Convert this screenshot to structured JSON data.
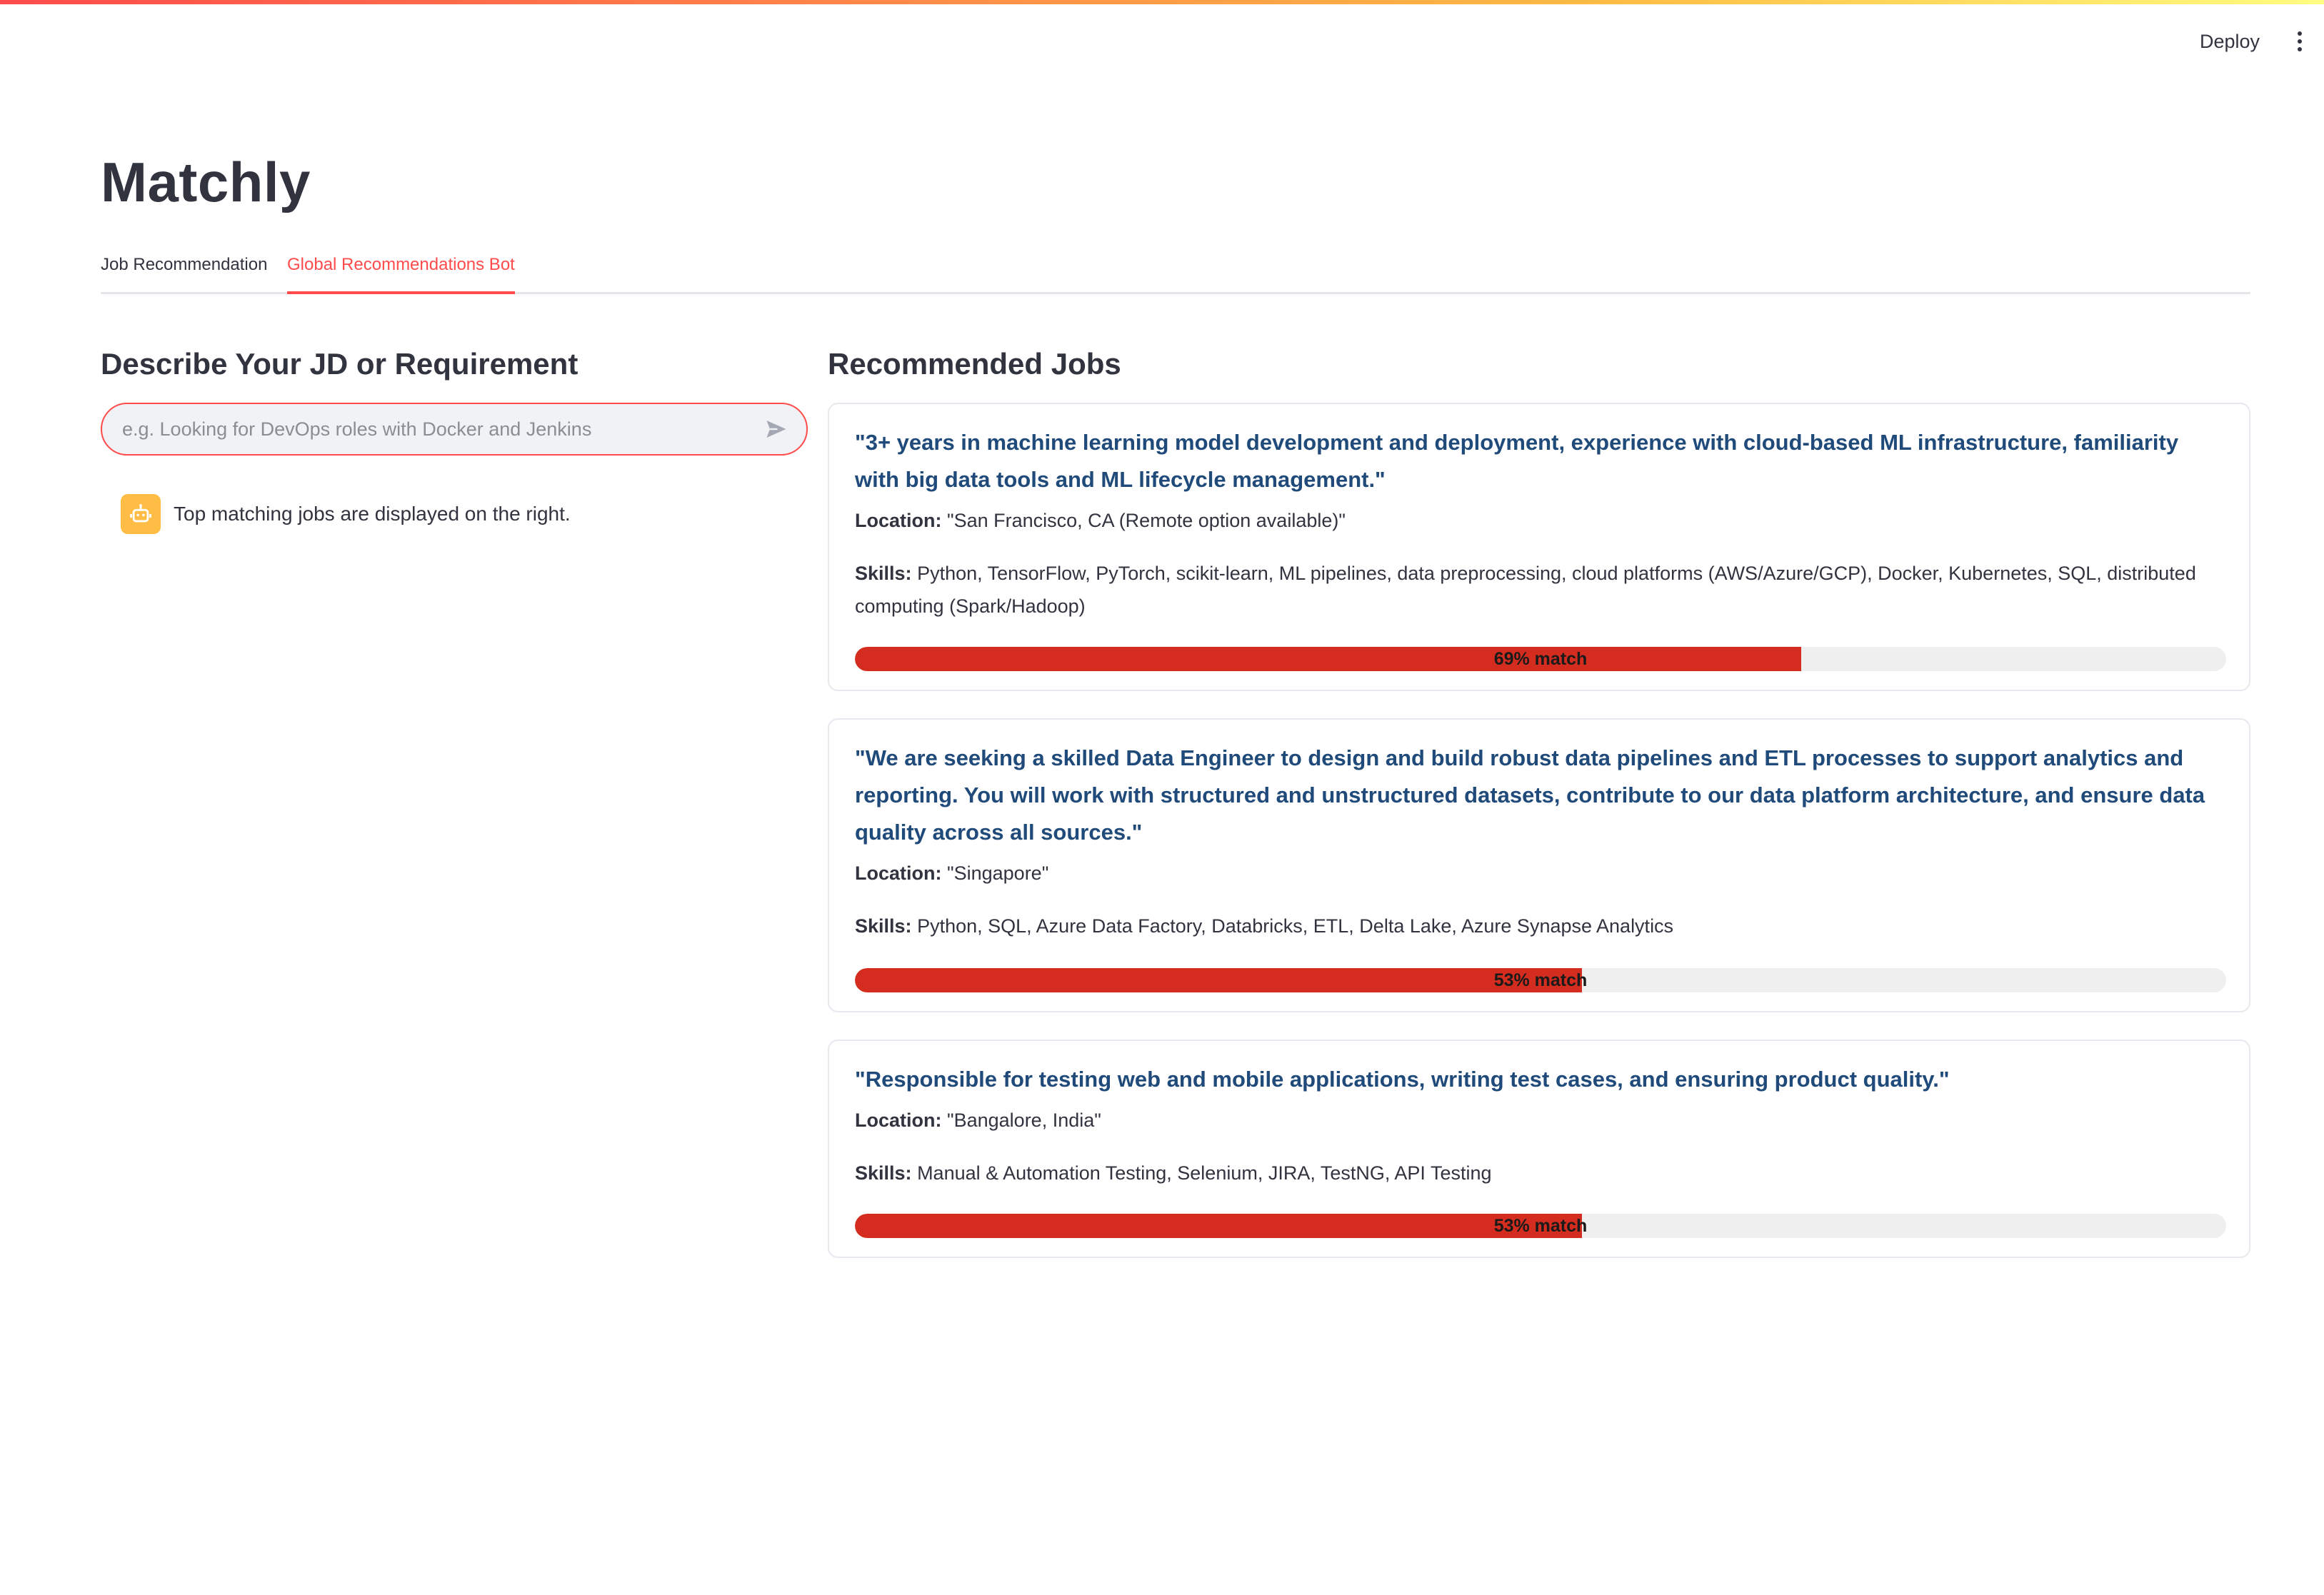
{
  "header": {
    "deploy_label": "Deploy"
  },
  "app": {
    "title": "Matchly"
  },
  "tabs": [
    {
      "label": "Job Recommendation",
      "active": false
    },
    {
      "label": "Global Recommendations Bot",
      "active": true
    }
  ],
  "left": {
    "heading": "Describe Your JD or Requirement",
    "input": {
      "value": "",
      "placeholder": "e.g. Looking for DevOps roles with Docker and Jenkins"
    },
    "bot_message": "Top matching jobs are displayed on the right."
  },
  "right": {
    "heading": "Recommended Jobs",
    "location_label": "Location:",
    "skills_label": "Skills:",
    "jobs": [
      {
        "title": "\"3+ years in machine learning model development and deployment, experience with cloud-based ML infrastructure, familiarity with big data tools and ML lifecycle management.\"",
        "location": "\"San Francisco, CA (Remote option available)\"",
        "skills": "Python, TensorFlow, PyTorch, scikit-learn, ML pipelines, data preprocessing, cloud platforms (AWS/Azure/GCP), Docker, Kubernetes, SQL, distributed computing (Spark/Hadoop)",
        "match_percent": 69,
        "match_label": "69% match"
      },
      {
        "title": "\"We are seeking a skilled Data Engineer to design and build robust data pipelines and ETL processes to support analytics and reporting. You will work with structured and unstructured datasets, contribute to our data platform architecture, and ensure data quality across all sources.\"",
        "location": "\"Singapore\"",
        "skills": "Python, SQL, Azure Data Factory, Databricks, ETL, Delta Lake, Azure Synapse Analytics",
        "match_percent": 53,
        "match_label": "53% match"
      },
      {
        "title": "\"Responsible for testing web and mobile applications, writing test cases, and ensuring product quality.\"",
        "location": "\"Bangalore, India\"",
        "skills": "Manual & Automation Testing, Selenium, JIRA, TestNG, API Testing",
        "match_percent": 53,
        "match_label": "53% match"
      }
    ]
  },
  "colors": {
    "accent": "#ff4b4b",
    "match_bar": "#d42d1f",
    "job_title": "#1f4a7a",
    "bot_avatar": "#ffbd45"
  },
  "icons": {
    "send": "send-icon",
    "bot": "robot-icon",
    "menu": "more-vertical-icon"
  }
}
